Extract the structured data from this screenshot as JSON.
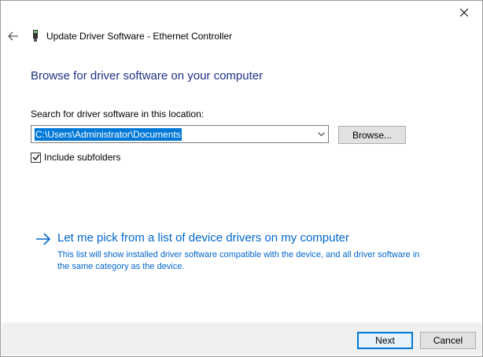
{
  "window": {
    "title": "Update Driver Software - Ethernet Controller"
  },
  "main": {
    "heading": "Browse for driver software on your computer",
    "search_label": "Search for driver software in this location:",
    "path_value": "C:\\Users\\Administrator\\Documents",
    "browse_label": "Browse...",
    "include_subfolders_label": "Include subfolders",
    "include_subfolders_checked": true
  },
  "pick_link": {
    "title": "Let me pick from a list of device drivers on my computer",
    "description": "This list will show installed driver software compatible with the device, and all driver software in the same category as the device."
  },
  "footer": {
    "next_label": "Next",
    "cancel_label": "Cancel"
  },
  "colors": {
    "heading": "#1e3287",
    "link": "#0066cc",
    "selection": "#0078d7",
    "footer_bg": "#f0f0f0"
  },
  "icons": {
    "close": "close-icon",
    "back": "back-arrow-icon",
    "device": "ethernet-device-icon",
    "dropdown": "chevron-down-icon",
    "link_arrow": "right-arrow-icon",
    "check": "checkmark-icon"
  }
}
